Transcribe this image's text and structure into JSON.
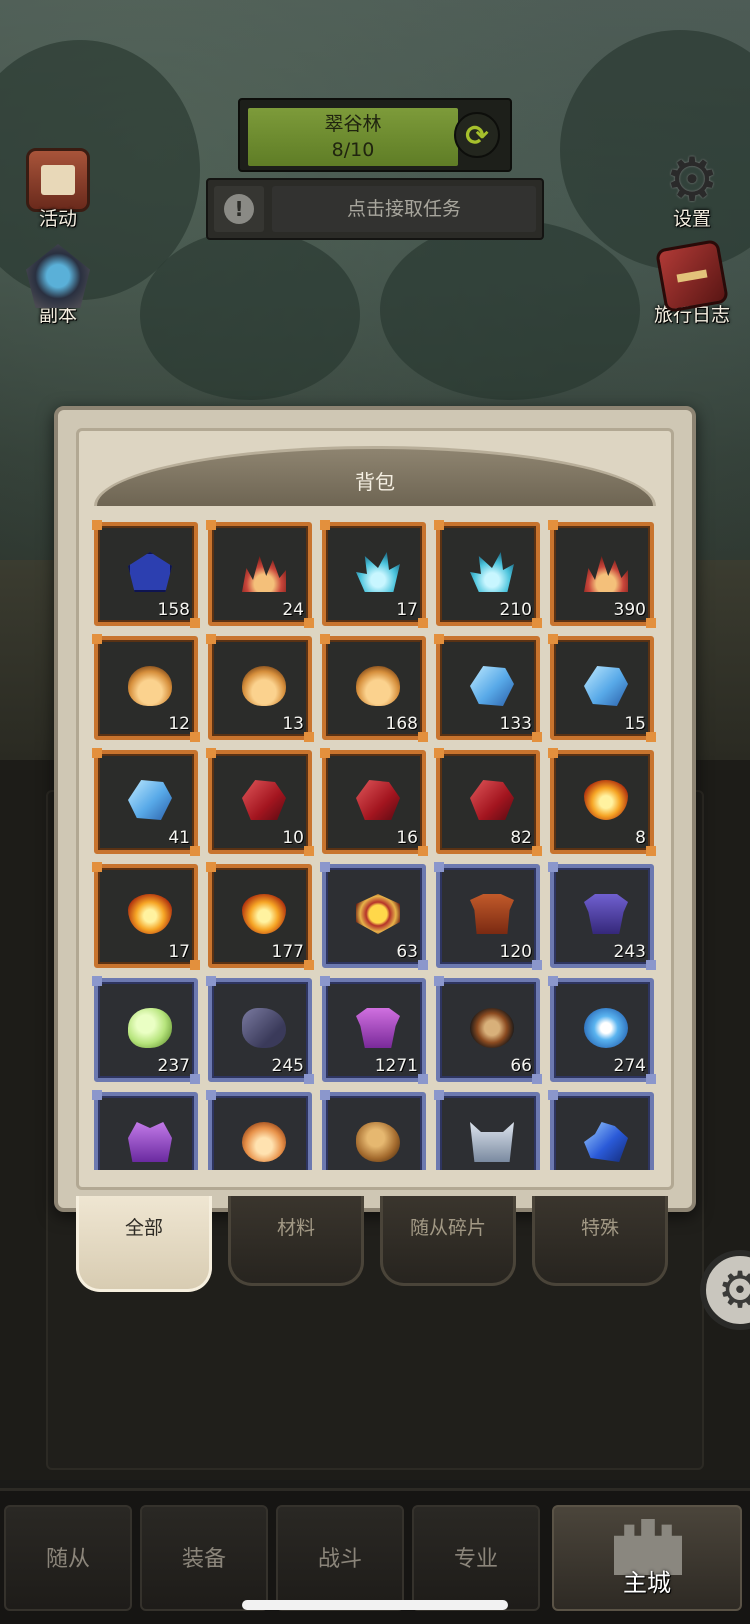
{
  "zone": {
    "name": "翠谷林",
    "progress": "8/10"
  },
  "quest": {
    "text": "点击接取任务",
    "alert_symbol": "!"
  },
  "side_left": [
    {
      "id": "activity",
      "label": "活动",
      "icon": "scroll-book-icon"
    },
    {
      "id": "dungeon",
      "label": "副本",
      "icon": "portal-icon"
    }
  ],
  "side_right": [
    {
      "id": "settings",
      "label": "设置",
      "icon": "gear-icon"
    },
    {
      "id": "journal",
      "label": "旅行日志",
      "icon": "journal-book-icon"
    }
  ],
  "backpack": {
    "title": "背包",
    "items": [
      {
        "icon": "gem-blue",
        "count": "158",
        "rarity": "orange"
      },
      {
        "icon": "flame-red",
        "count": "24",
        "rarity": "orange"
      },
      {
        "icon": "flame-cyan",
        "count": "17",
        "rarity": "orange"
      },
      {
        "icon": "flame-cyan",
        "count": "210",
        "rarity": "orange"
      },
      {
        "icon": "flame-red",
        "count": "390",
        "rarity": "orange"
      },
      {
        "icon": "pouch",
        "count": "12",
        "rarity": "orange"
      },
      {
        "icon": "pouch",
        "count": "13",
        "rarity": "orange"
      },
      {
        "icon": "pouch",
        "count": "168",
        "rarity": "orange"
      },
      {
        "icon": "crystal-blue",
        "count": "133",
        "rarity": "orange"
      },
      {
        "icon": "crystal-blue",
        "count": "15",
        "rarity": "orange"
      },
      {
        "icon": "crystal-blue",
        "count": "41",
        "rarity": "orange"
      },
      {
        "icon": "ruby",
        "count": "10",
        "rarity": "orange"
      },
      {
        "icon": "ruby",
        "count": "16",
        "rarity": "orange"
      },
      {
        "icon": "ruby",
        "count": "82",
        "rarity": "orange"
      },
      {
        "icon": "orb-fire",
        "count": "8",
        "rarity": "orange"
      },
      {
        "icon": "orb-fire",
        "count": "17",
        "rarity": "orange"
      },
      {
        "icon": "orb-fire",
        "count": "177",
        "rarity": "orange"
      },
      {
        "icon": "emblem",
        "count": "63",
        "rarity": "blue"
      },
      {
        "icon": "armor-orange",
        "count": "120",
        "rarity": "blue"
      },
      {
        "icon": "armor-purple",
        "count": "243",
        "rarity": "blue"
      },
      {
        "icon": "slime",
        "count": "237",
        "rarity": "blue"
      },
      {
        "icon": "pauldron",
        "count": "245",
        "rarity": "blue"
      },
      {
        "icon": "armor-magenta",
        "count": "1271",
        "rarity": "blue"
      },
      {
        "icon": "mask",
        "count": "66",
        "rarity": "blue"
      },
      {
        "icon": "snowflake",
        "count": "274",
        "rarity": "blue"
      },
      {
        "icon": "helm-purple",
        "count": "",
        "rarity": "blue"
      },
      {
        "icon": "ember",
        "count": "",
        "rarity": "blue"
      },
      {
        "icon": "rock",
        "count": "",
        "rarity": "blue"
      },
      {
        "icon": "helm-steel",
        "count": "",
        "rarity": "blue"
      },
      {
        "icon": "crystal-shard",
        "count": "",
        "rarity": "blue"
      }
    ]
  },
  "tabs": [
    {
      "label": "全部",
      "active": true
    },
    {
      "label": "材料",
      "active": false
    },
    {
      "label": "随从碎片",
      "active": false
    },
    {
      "label": "特殊",
      "active": false
    }
  ],
  "bottom_nav": [
    {
      "label": "随从"
    },
    {
      "label": "装备"
    },
    {
      "label": "战斗"
    },
    {
      "label": "专业"
    },
    {
      "label": "主城",
      "active": true
    }
  ],
  "colors": {
    "rarity_orange": "#c8742e",
    "rarity_blue": "#6c79b0",
    "zone_bar": "#6f8d2f",
    "panel_parchment": "#ddd5c2"
  }
}
